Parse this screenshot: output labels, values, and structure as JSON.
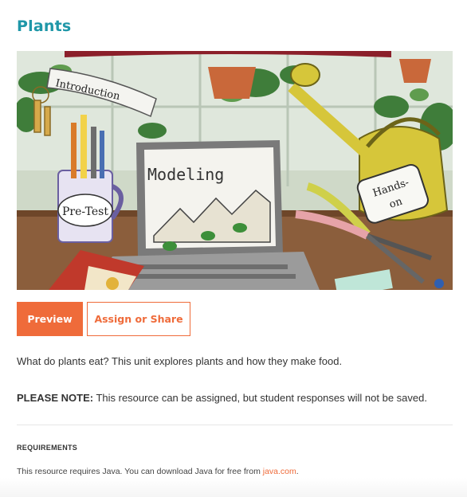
{
  "page": {
    "title": "Plants"
  },
  "hero": {
    "labels": {
      "introduction": "Introduction",
      "modeling": "Modeling",
      "pretest": "Pre-Test",
      "handson_line1": "Hands-",
      "handson_line2": "on"
    }
  },
  "actions": {
    "preview_label": "Preview",
    "assign_label": "Assign or Share"
  },
  "description": "What do plants eat? This unit explores plants and how they make food.",
  "note": {
    "label": "PLEASE NOTE:",
    "text": " This resource can be assigned, but student responses will not be saved."
  },
  "requirements": {
    "heading": "REQUIREMENTS",
    "text_before": "This resource requires Java. You can download Java for free from ",
    "link_text": "java.com",
    "text_after": "."
  },
  "colors": {
    "title": "#1f97a8",
    "accent": "#ef6b3a"
  }
}
